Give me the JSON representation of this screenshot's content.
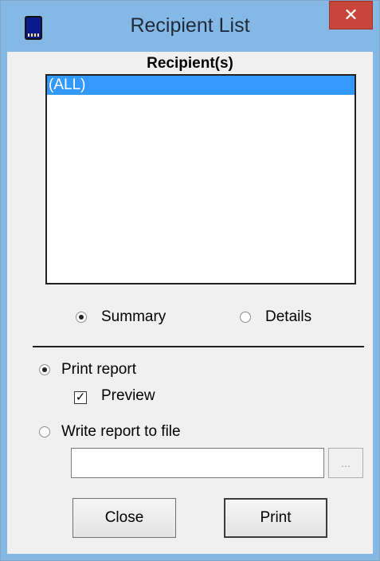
{
  "window": {
    "title": "Recipient List",
    "close_glyph": "✕",
    "icon": "handheld-device-icon"
  },
  "recipients": {
    "label": "Recipient(s)",
    "items": [
      {
        "label": "(ALL)",
        "selected": true
      }
    ]
  },
  "detail_level": {
    "summary_label": "Summary",
    "details_label": "Details",
    "selected": "Summary"
  },
  "output": {
    "print_label": "Print report",
    "preview_label": "Preview",
    "preview_checked": true,
    "file_label": "Write report to file",
    "file_path": "",
    "browse_label": "...",
    "selected": "Print report"
  },
  "buttons": {
    "close_label": "Close",
    "print_label": "Print"
  },
  "colors": {
    "titlebar": "#85b8e4",
    "close_button": "#c7453b",
    "selection": "#3399ff",
    "dialog_background": "#f0f0f0"
  }
}
